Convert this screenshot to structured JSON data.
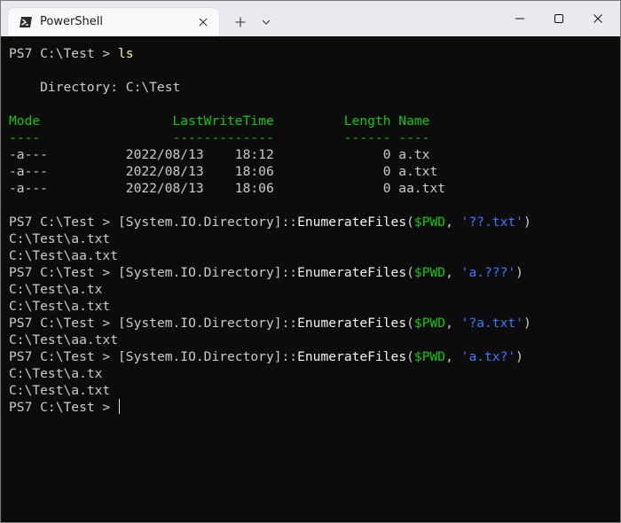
{
  "window": {
    "tab_title": "PowerShell",
    "icons": {
      "tab": "powershell-icon",
      "tab_close": "close-icon",
      "new_tab": "plus-icon",
      "dropdown": "chevron-down-icon",
      "minimize": "minimize-icon",
      "maximize": "maximize-icon",
      "close": "close-icon"
    }
  },
  "colors": {
    "background": "#0c0c0c",
    "foreground": "#cccccc",
    "green": "#16c60c",
    "yellow": "#f9f1a5",
    "blue": "#3b78ff",
    "white": "#f2f2f2"
  },
  "terminal": {
    "lines": [
      [
        {
          "t": "PS7 C:\\Test > ",
          "c": "gray"
        },
        {
          "t": "ls",
          "c": "yellow"
        }
      ],
      [],
      [
        {
          "t": "    Directory: C:\\Test",
          "c": "gray"
        }
      ],
      [],
      [
        {
          "t": "Mode                 LastWriteTime         Length Name",
          "c": "green"
        }
      ],
      [
        {
          "t": "----                 -------------         ------ ----",
          "c": "green"
        }
      ],
      [
        {
          "t": "-a---          2022/08/13    18:12              0 a.tx",
          "c": "gray"
        }
      ],
      [
        {
          "t": "-a---          2022/08/13    18:06              0 a.txt",
          "c": "gray"
        }
      ],
      [
        {
          "t": "-a---          2022/08/13    18:06              0 aa.txt",
          "c": "gray"
        }
      ],
      [],
      [
        {
          "t": "PS7 C:\\Test > ",
          "c": "gray"
        },
        {
          "t": "[System.IO.Directory]::",
          "c": "gray"
        },
        {
          "t": "EnumerateFiles",
          "c": "white"
        },
        {
          "t": "(",
          "c": "gray"
        },
        {
          "t": "$PWD",
          "c": "green"
        },
        {
          "t": ", ",
          "c": "gray"
        },
        {
          "t": "'??.txt'",
          "c": "blue"
        },
        {
          "t": ")",
          "c": "gray"
        }
      ],
      [
        {
          "t": "C:\\Test\\a.txt",
          "c": "gray"
        }
      ],
      [
        {
          "t": "C:\\Test\\aa.txt",
          "c": "gray"
        }
      ],
      [
        {
          "t": "PS7 C:\\Test > ",
          "c": "gray"
        },
        {
          "t": "[System.IO.Directory]::",
          "c": "gray"
        },
        {
          "t": "EnumerateFiles",
          "c": "white"
        },
        {
          "t": "(",
          "c": "gray"
        },
        {
          "t": "$PWD",
          "c": "green"
        },
        {
          "t": ", ",
          "c": "gray"
        },
        {
          "t": "'a.???'",
          "c": "blue"
        },
        {
          "t": ")",
          "c": "gray"
        }
      ],
      [
        {
          "t": "C:\\Test\\a.tx",
          "c": "gray"
        }
      ],
      [
        {
          "t": "C:\\Test\\a.txt",
          "c": "gray"
        }
      ],
      [
        {
          "t": "PS7 C:\\Test > ",
          "c": "gray"
        },
        {
          "t": "[System.IO.Directory]::",
          "c": "gray"
        },
        {
          "t": "EnumerateFiles",
          "c": "white"
        },
        {
          "t": "(",
          "c": "gray"
        },
        {
          "t": "$PWD",
          "c": "green"
        },
        {
          "t": ", ",
          "c": "gray"
        },
        {
          "t": "'?a.txt'",
          "c": "blue"
        },
        {
          "t": ")",
          "c": "gray"
        }
      ],
      [
        {
          "t": "C:\\Test\\aa.txt",
          "c": "gray"
        }
      ],
      [
        {
          "t": "PS7 C:\\Test > ",
          "c": "gray"
        },
        {
          "t": "[System.IO.Directory]::",
          "c": "gray"
        },
        {
          "t": "EnumerateFiles",
          "c": "white"
        },
        {
          "t": "(",
          "c": "gray"
        },
        {
          "t": "$PWD",
          "c": "green"
        },
        {
          "t": ", ",
          "c": "gray"
        },
        {
          "t": "'a.tx?'",
          "c": "blue"
        },
        {
          "t": ")",
          "c": "gray"
        }
      ],
      [
        {
          "t": "C:\\Test\\a.tx",
          "c": "gray"
        }
      ],
      [
        {
          "t": "C:\\Test\\a.txt",
          "c": "gray"
        }
      ],
      [
        {
          "t": "PS7 C:\\Test > ",
          "c": "gray"
        },
        {
          "cursor": true
        }
      ]
    ]
  }
}
